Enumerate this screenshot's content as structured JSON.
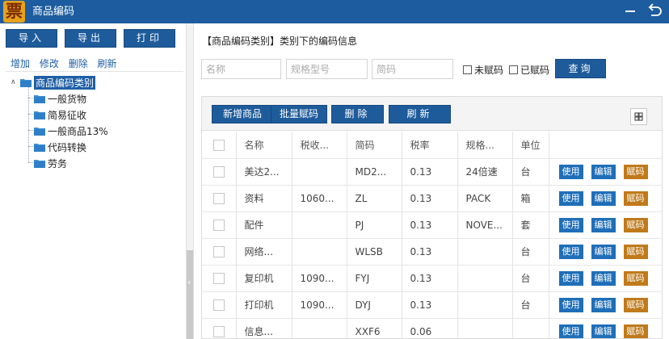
{
  "window": {
    "title": "商品编码",
    "logo_text": "票"
  },
  "left_panel": {
    "buttons": {
      "import": "导入",
      "export": "导出",
      "print": "打印"
    },
    "actions": {
      "add": "增加",
      "modify": "修改",
      "delete": "删除",
      "refresh": "刷新"
    },
    "tree": {
      "root": "商品编码类别",
      "children": [
        "一般货物",
        "简易征收",
        "一般商品13%",
        "代码转换",
        "劳务"
      ]
    }
  },
  "right_panel": {
    "title": "【商品编码类别】类别下的编码信息",
    "filters": {
      "name_placeholder": "名称",
      "spec_placeholder": "规格型号",
      "code_placeholder": "简码",
      "unassigned_label": "未赋码",
      "assigned_label": "已赋码",
      "query_label": "查询"
    },
    "toolbar": {
      "add": "新增商品",
      "batch": "批量赋码",
      "delete": "删除",
      "refresh": "刷新"
    },
    "table": {
      "columns": [
        "名称",
        "税收...",
        "简码",
        "税率",
        "规格...",
        "单位"
      ],
      "rows": [
        {
          "name": "美达2...",
          "tax": "",
          "code": "MD2...",
          "rate": "0.13",
          "spec": "24倍速",
          "unit": "台"
        },
        {
          "name": "资料",
          "tax": "1060...",
          "code": "ZL",
          "rate": "0.13",
          "spec": "PACK",
          "unit": "箱"
        },
        {
          "name": "配件",
          "tax": "",
          "code": "PJ",
          "rate": "0.13",
          "spec": "NOVE...",
          "unit": "套"
        },
        {
          "name": "网络...",
          "tax": "",
          "code": "WLSB",
          "rate": "0.13",
          "spec": "",
          "unit": "台"
        },
        {
          "name": "复印机",
          "tax": "1090...",
          "code": "FYJ",
          "rate": "0.13",
          "spec": "",
          "unit": "台"
        },
        {
          "name": "打印机",
          "tax": "1090...",
          "code": "DYJ",
          "rate": "0.13",
          "spec": "",
          "unit": "台"
        },
        {
          "name": "信息...",
          "tax": "",
          "code": "XXF6",
          "rate": "0.06",
          "spec": "",
          "unit": ""
        }
      ],
      "row_actions": {
        "use": "使用",
        "edit": "编辑",
        "assign": "赋码"
      }
    }
  },
  "colors": {
    "primary": "#1e5b9b",
    "title_bar": "#1d5c9e",
    "assign_button": "#c07a1a",
    "logo": "#e8a21a"
  }
}
